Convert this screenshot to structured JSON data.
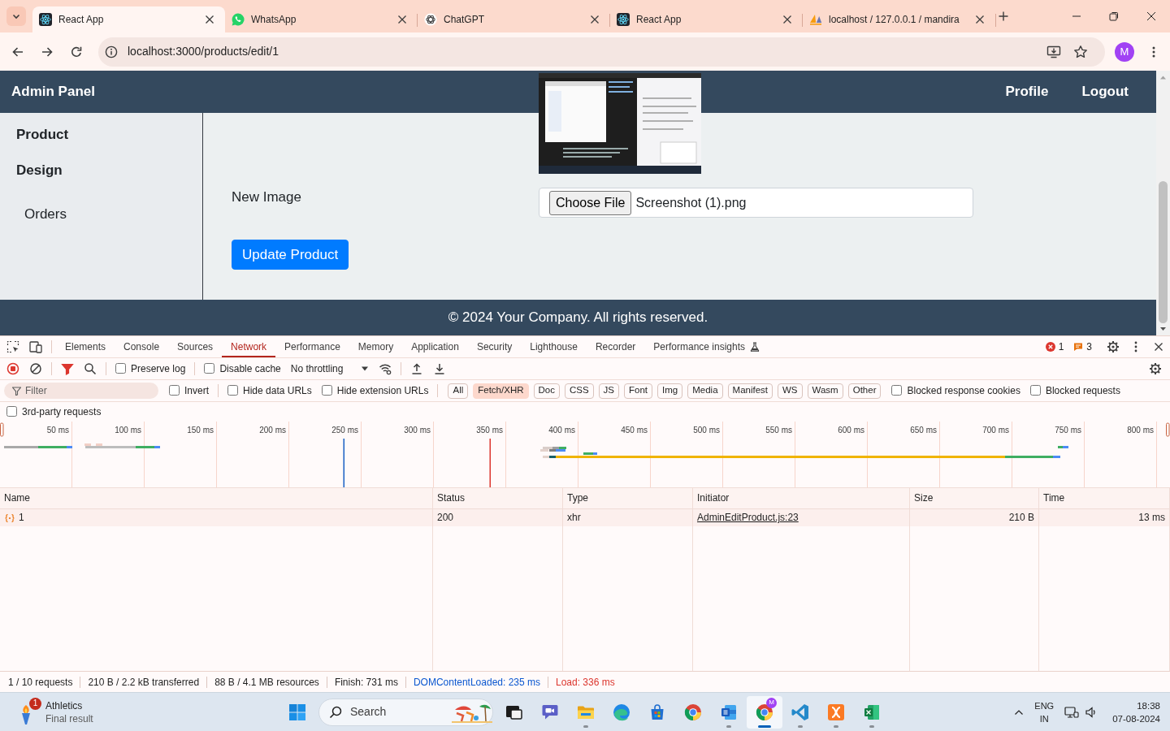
{
  "browser": {
    "tabs": [
      {
        "title": "React App",
        "kind": "react",
        "selected": true
      },
      {
        "title": "WhatsApp",
        "kind": "whatsapp",
        "selected": false
      },
      {
        "title": "ChatGPT",
        "kind": "chatgpt",
        "selected": false
      },
      {
        "title": "React App",
        "kind": "react",
        "selected": false
      },
      {
        "title": "localhost / 127.0.0.1 / mandira",
        "kind": "phpmyadmin",
        "selected": false
      }
    ],
    "address": "localhost:3000/products/edit/1",
    "profile": "M"
  },
  "app": {
    "navbar": {
      "brand": "Admin Panel",
      "links": [
        "Profile",
        "Logout"
      ]
    },
    "sidebar": {
      "items": [
        {
          "label": "Product",
          "kind": "heading"
        },
        {
          "label": "Design",
          "kind": "heading"
        },
        {
          "label": "Orders",
          "kind": "link"
        }
      ]
    },
    "form": {
      "fields": [
        {
          "label": "New Image",
          "button": "Choose File",
          "file_name": "Screenshot (1).png"
        }
      ],
      "submit": "Update Product"
    },
    "footer": "© 2024 Your Company. All rights reserved."
  },
  "devtools": {
    "tabs": [
      {
        "label": "Elements",
        "selected": false,
        "experimental": false
      },
      {
        "label": "Console",
        "selected": false,
        "experimental": false
      },
      {
        "label": "Sources",
        "selected": false,
        "experimental": false
      },
      {
        "label": "Network",
        "selected": true,
        "experimental": false
      },
      {
        "label": "Performance",
        "selected": false,
        "experimental": false
      },
      {
        "label": "Memory",
        "selected": false,
        "experimental": false
      },
      {
        "label": "Application",
        "selected": false,
        "experimental": false
      },
      {
        "label": "Security",
        "selected": false,
        "experimental": false
      },
      {
        "label": "Lighthouse",
        "selected": false,
        "experimental": false
      },
      {
        "label": "Recorder",
        "selected": false,
        "experimental": false
      },
      {
        "label": "Performance insights",
        "selected": false,
        "experimental": true
      }
    ],
    "errors": "1",
    "issues": "3",
    "toolbar": {
      "recording": true,
      "filter_shown": true,
      "checkboxes": [
        {
          "label": "Preserve log",
          "checked": false
        },
        {
          "label": "Disable cache",
          "checked": false
        }
      ],
      "throttling": "No throttling"
    },
    "filter": {
      "placeholder": "Filter",
      "options": [
        {
          "label": "Invert",
          "checked": false
        },
        {
          "label": "Hide data URLs",
          "checked": false
        },
        {
          "label": "Hide extension URLs",
          "checked": false
        }
      ],
      "types": [
        {
          "label": "All",
          "selected": false
        },
        {
          "label": "Fetch/XHR",
          "selected": true
        },
        {
          "label": "Doc",
          "selected": false
        },
        {
          "label": "CSS",
          "selected": false
        },
        {
          "label": "JS",
          "selected": false
        },
        {
          "label": "Font",
          "selected": false
        },
        {
          "label": "Img",
          "selected": false
        },
        {
          "label": "Media",
          "selected": false
        },
        {
          "label": "Manifest",
          "selected": false
        },
        {
          "label": "WS",
          "selected": false
        },
        {
          "label": "Wasm",
          "selected": false
        },
        {
          "label": "Other",
          "selected": false
        }
      ],
      "blocking": [
        {
          "label": "Blocked response cookies",
          "checked": false
        },
        {
          "label": "Blocked requests",
          "checked": false
        }
      ],
      "third_party": {
        "label": "3rd-party requests",
        "checked": false
      }
    },
    "overview": {
      "ticks": [
        "50 ms",
        "100 ms",
        "150 ms",
        "200 ms",
        "250 ms",
        "300 ms",
        "350 ms",
        "400 ms",
        "450 ms",
        "500 ms",
        "550 ms",
        "600 ms",
        "650 ms",
        "700 ms",
        "750 ms",
        "800 ms"
      ]
    },
    "table": {
      "columns": [
        "Name",
        "Status",
        "Type",
        "Initiator",
        "Size",
        "Time"
      ],
      "rows": [
        {
          "name": "1",
          "status": "200",
          "type": "xhr",
          "initiator": "AdminEditProduct.js:23",
          "size": "210 B",
          "time": "13 ms"
        }
      ]
    },
    "summary": [
      {
        "text": "1 / 10 requests",
        "color": "#1f1f1f"
      },
      {
        "text": "210 B / 2.2 kB transferred",
        "color": "#1f1f1f"
      },
      {
        "text": "88 B / 4.1 MB resources",
        "color": "#1f1f1f"
      },
      {
        "text": "Finish: 731 ms",
        "color": "#1f1f1f"
      },
      {
        "text": "DOMContentLoaded: 235 ms",
        "color": "#0b57d0"
      },
      {
        "text": "Load: 336 ms",
        "color": "#dc362e"
      }
    ]
  },
  "taskbar": {
    "widget": {
      "title": "Athletics",
      "subtitle": "Final result",
      "badge": "1"
    },
    "search_label": "Search",
    "apps": [
      {
        "kind": "task_view",
        "running": false,
        "selected": false
      },
      {
        "kind": "chat",
        "running": false,
        "selected": false
      },
      {
        "kind": "files",
        "running": true,
        "selected": false
      },
      {
        "kind": "edge",
        "running": false,
        "selected": false
      },
      {
        "kind": "store",
        "running": false,
        "selected": false
      },
      {
        "kind": "chrome",
        "running": false,
        "selected": false
      },
      {
        "kind": "word",
        "running": true,
        "selected": false
      },
      {
        "kind": "chrome",
        "running": true,
        "selected": true,
        "badge": "M"
      },
      {
        "kind": "vscode",
        "running": true,
        "selected": false
      },
      {
        "kind": "xampp",
        "running": true,
        "selected": false
      },
      {
        "kind": "excel",
        "running": true,
        "selected": false
      }
    ],
    "language": "ENG",
    "region": "IN",
    "time": "18:38",
    "date": "07-08-2024"
  }
}
